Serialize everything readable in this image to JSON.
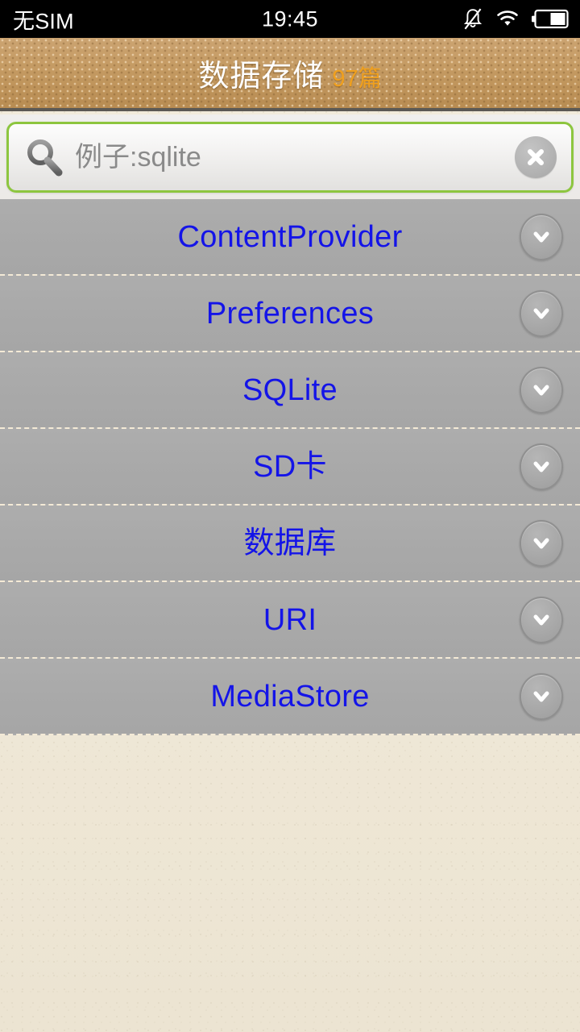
{
  "statusbar": {
    "carrier": "无SIM",
    "clock": "19:45",
    "icons": [
      "bell-muted-icon",
      "wifi-icon",
      "battery-icon"
    ]
  },
  "header": {
    "title": "数据存储",
    "count": "97篇",
    "title_color": "#ffffff",
    "count_color": "#f0a01e",
    "background_color": "#c49a62"
  },
  "search": {
    "value": "",
    "placeholder": "例子:sqlite",
    "icon": "search-icon",
    "clear_icon": "clear-circle-icon",
    "border_color": "#8dc63f"
  },
  "list": {
    "item_text_color": "#1414e8",
    "row_background": "#a9a9a9",
    "expand_icon": "chevron-down-icon",
    "items": [
      {
        "label": "ContentProvider"
      },
      {
        "label": "Preferences"
      },
      {
        "label": "SQLite"
      },
      {
        "label": "SD卡"
      },
      {
        "label": "数据库"
      },
      {
        "label": "URI"
      },
      {
        "label": "MediaStore"
      }
    ]
  },
  "page_background_color": "#f1ead9"
}
